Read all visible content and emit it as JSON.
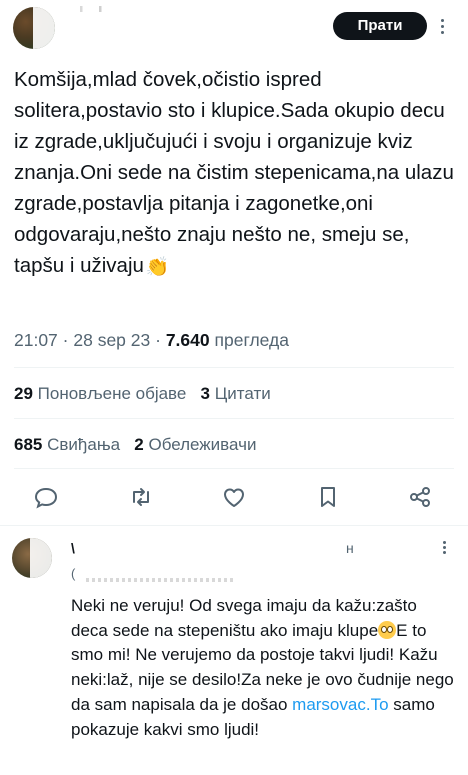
{
  "post": {
    "follow_label": "Прати",
    "text": "Komšija,mlad čovek,očistio ispred solitera,postavio sto i klupice.Sada okupio decu iz zgrade,uključujući i svoju i organizuje kviz znanja.Oni sede na čistim stepenicama,na ulazu zgrade,postavlja pitanja i zagonetke,oni odgovaraju,nešto znaju nešto ne, smeju se, tapšu i uživaju",
    "emoji": "👏",
    "time": "21:07",
    "date": "28 sep 23",
    "dot": "·",
    "views_count": "7.640",
    "views_label": "прегледа"
  },
  "stats": {
    "reposts_count": "29",
    "reposts_label": "Поновљене објаве",
    "quotes_count": "3",
    "quotes_label": "Цитати",
    "likes_count": "685",
    "likes_label": "Свиђања",
    "bookmarks_count": "2",
    "bookmarks_label": "Обележивачи"
  },
  "actions": [
    "reply-icon",
    "repost-icon",
    "like-icon",
    "bookmark-icon",
    "share-icon"
  ],
  "reply": {
    "name_mark": "\\",
    "handle_mark": "(",
    "time_mark": "н",
    "text_before_emoji": "Neki ne veruju! Od svega imaju da kažu:zašto deca sede na stepeništu ako imaju klupe",
    "text_after_emoji": "E to smo mi! Ne verujemo da postoje takvi ljudi! Kažu neki:laž, nije se desilo!Za neke je ovo čudnije nego da sam napisala da je došao ",
    "link": "marsovac.To",
    "text_after_link": " samo pokazuje kakvi smo ljudi!"
  },
  "colors": {
    "text": "#0f1419",
    "secondary": "#536471",
    "link": "#1d9bf0",
    "divider": "#eff3f4",
    "button_bg": "#0f1419"
  }
}
